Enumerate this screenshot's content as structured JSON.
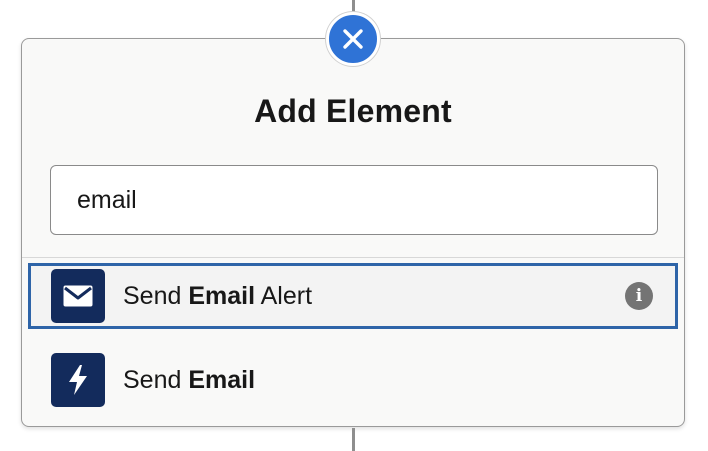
{
  "panel": {
    "title": "Add Element",
    "close_icon": "close-icon"
  },
  "search": {
    "value": "email",
    "placeholder": ""
  },
  "results": [
    {
      "icon": "envelope-icon",
      "label_prefix": "Send ",
      "label_bold": "Email",
      "label_suffix": " Alert",
      "selected": true,
      "info_icon": "info-icon",
      "info_glyph": "i"
    },
    {
      "icon": "lightning-bolt-icon",
      "label_prefix": "Send ",
      "label_bold": "Email",
      "label_suffix": "",
      "selected": false
    }
  ],
  "colors": {
    "close_button": "#2f73d6",
    "item_icon_bg": "#132b5c",
    "selected_border": "#2e64a8",
    "info_icon_bg": "#747474"
  }
}
